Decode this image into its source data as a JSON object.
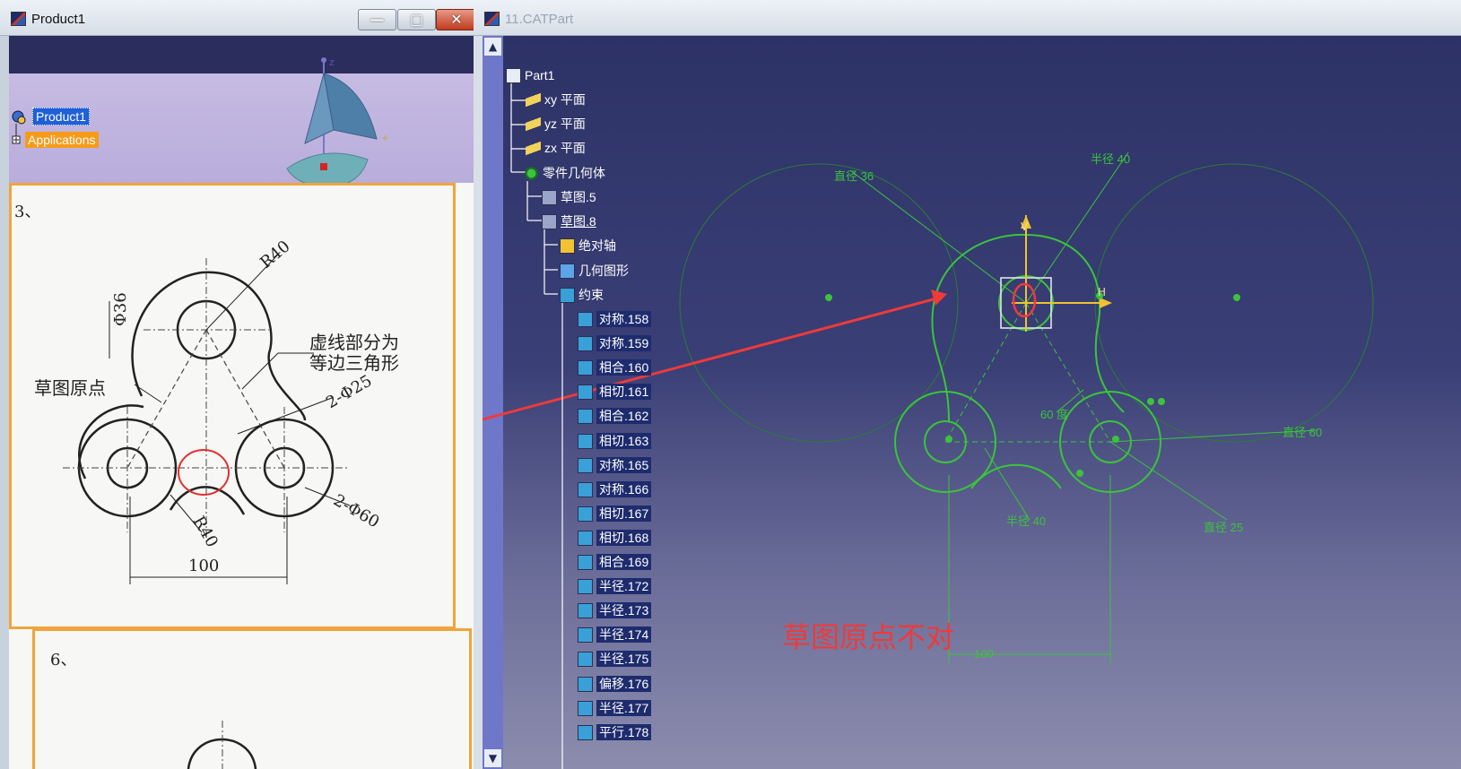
{
  "left_window": {
    "title": "Product1",
    "controls": {
      "minimize": "—",
      "maximize": "▢",
      "close": "✕"
    },
    "tree": {
      "product": "Product1",
      "applications": "Applications"
    },
    "compass_axis": "z",
    "drawing": {
      "problem_3": "3、",
      "problem_6": "6、",
      "dim_r40_top": "R40",
      "dim_phi36": "Φ36",
      "note_line1": "虚线部分为",
      "note_line2": "等边三角形",
      "sketch_origin": "草图原点",
      "dim_2phi25": "2-Φ25",
      "dim_2phi60": "2-Φ60",
      "dim_r40_bottom": "R40",
      "dim_100": "100"
    }
  },
  "right_window": {
    "title": "11.CATPart",
    "scroll": {
      "up": "▲",
      "down": "▼"
    },
    "tree": {
      "root": "Part1",
      "planes": [
        "xy 平面",
        "yz 平面",
        "zx 平面"
      ],
      "body": "零件几何体",
      "sketch5": "草图.5",
      "sketch8": "草图.8",
      "absolute_axis": "绝对轴",
      "geometry": "几何图形",
      "constraints": "约束",
      "constraint_items": [
        "对称.158",
        "对称.159",
        "相合.160",
        "相切.161",
        "相合.162",
        "相切.163",
        "对称.165",
        "对称.166",
        "相切.167",
        "相切.168",
        "相合.169",
        "半径.172",
        "半径.173",
        "半径.174",
        "半径.175",
        "偏移.176",
        "半径.177",
        "平行.178"
      ]
    },
    "sketch_dims": {
      "dia36": "直径 36",
      "rad40_top": "半径 40",
      "angle60": "60 度",
      "dia60": "直径 60",
      "rad40_bottom": "半径 40",
      "dia25": "直径 25",
      "len100": "100",
      "v_axis": "V",
      "h_axis": "H"
    },
    "annotation": "草图原点不对"
  },
  "colors": {
    "sketch_green": "#3bc43b",
    "annotation_red": "#ef3a3a",
    "selection_blue": "#1f5fd7",
    "applications_orange": "#f79a1a"
  }
}
